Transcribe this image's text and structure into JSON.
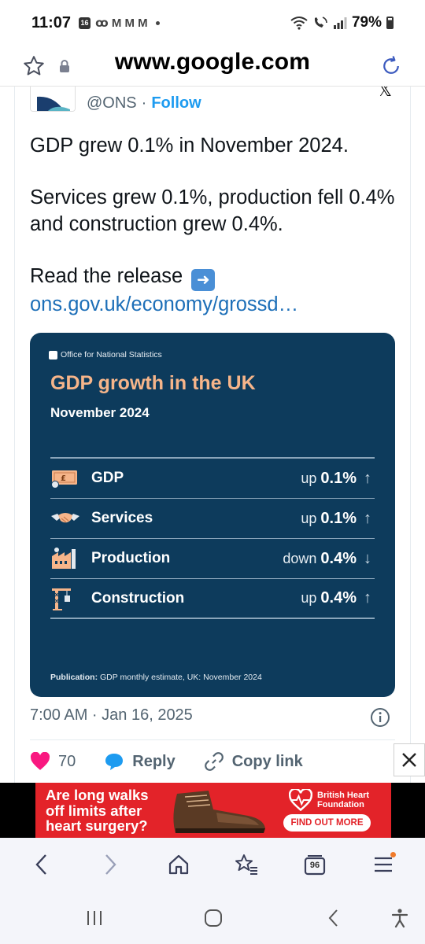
{
  "status_bar": {
    "time": "11:07",
    "badge": "16",
    "glyphs": "ꝏ M M M",
    "battery": "79%"
  },
  "browser": {
    "url": "www.google.com"
  },
  "tweet": {
    "handle": "@ONS",
    "separator": "·",
    "follow_label": "Follow",
    "lines": [
      "GDP grew 0.1% in November 2024.",
      "Services grew 0.1%, production fell 0.4% and construction grew 0.4%."
    ],
    "release_text": "Read the release",
    "link_text": "ons.gov.uk/economy/grossd…",
    "timestamp": "7:00 AM · Jan 16, 2025",
    "likes": "70",
    "reply_label": "Reply",
    "copy_link_label": "Copy link"
  },
  "infographic": {
    "org": "Office for National Statistics",
    "title": "GDP growth in the UK",
    "subtitle": "November 2024",
    "rows": [
      {
        "label": "GDP",
        "direction": "up",
        "value": "0.1%",
        "arrow": "↑",
        "icon": "banknote-icon"
      },
      {
        "label": "Services",
        "direction": "up",
        "value": "0.1%",
        "arrow": "↑",
        "icon": "handshake-icon"
      },
      {
        "label": "Production",
        "direction": "down",
        "value": "0.4%",
        "arrow": "↓",
        "icon": "factory-icon"
      },
      {
        "label": "Construction",
        "direction": "up",
        "value": "0.4%",
        "arrow": "↑",
        "icon": "crane-icon"
      }
    ],
    "footer_label": "Publication:",
    "footer_text": "GDP monthly estimate, UK: November 2024"
  },
  "ad": {
    "headline": "Are long walks off limits after heart surgery?",
    "brand": "British Heart Foundation",
    "cta": "FIND OUT MORE"
  },
  "browser_nav": {
    "tab_count": "96"
  },
  "colors": {
    "card_bg": "#0d3b5c",
    "card_title": "#f6b58a",
    "link": "#1d6fb8",
    "follow": "#1d9bf0",
    "like": "#f91880",
    "ad_red": "#e32329"
  }
}
